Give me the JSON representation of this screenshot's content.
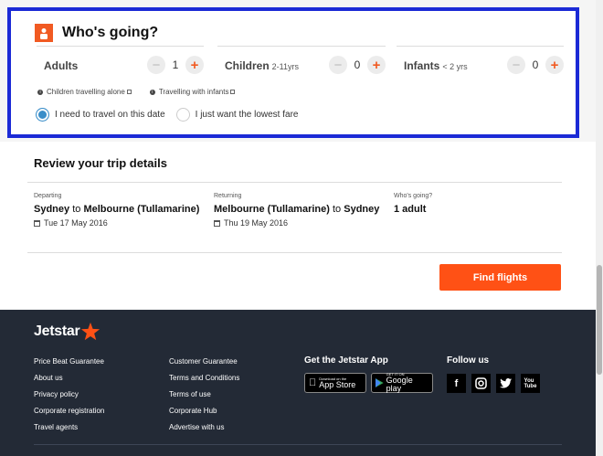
{
  "whos_going": {
    "title": "Who's going?",
    "icon": "person-icon",
    "adults": {
      "label": "Adults",
      "sub": "",
      "count": "1"
    },
    "children": {
      "label": "Children",
      "sub": "2-11yrs",
      "count": "0"
    },
    "infants": {
      "label": "Infants",
      "sub": "< 2 yrs",
      "count": "0"
    },
    "minus": "−",
    "plus": "+",
    "info_links": [
      "Children travelling alone",
      "Travelling with infants"
    ],
    "radio_options": [
      "I need to travel on this date",
      "I just want the lowest fare"
    ],
    "selected_option": "I need to travel on this date"
  },
  "review": {
    "title": "Review your trip details",
    "departing": {
      "label": "Departing",
      "from": "Sydney",
      "to_word": "to",
      "to": "Melbourne (Tullamarine)",
      "date": "Tue 17 May 2016"
    },
    "returning": {
      "label": "Returning",
      "from": "Melbourne (Tullamarine)",
      "to_word": "to",
      "to": "Sydney",
      "date": "Thu 19 May 2016"
    },
    "passengers": {
      "label": "Who's going?",
      "value": "1 adult"
    },
    "cta": "Find flights"
  },
  "footer": {
    "logo": "Jetstar",
    "col1": [
      "Price Beat Guarantee",
      "About us",
      "Privacy policy",
      "Corporate registration",
      "Travel agents"
    ],
    "col2": [
      "Customer Guarantee",
      "Terms and Conditions",
      "Terms of use",
      "Corporate Hub",
      "Advertise with us"
    ],
    "app_title": "Get the Jetstar App",
    "app_store": {
      "small": "Download on the",
      "big": "App Store"
    },
    "google_play": {
      "small": "GET IT ON",
      "big": "Google play"
    },
    "follow_title": "Follow us",
    "social": [
      "facebook-icon",
      "instagram-icon",
      "twitter-icon",
      "youtube-icon"
    ]
  },
  "colors": {
    "accent": "#ff5115",
    "focus_border": "#1b2ad6",
    "footer_bg": "#232a36",
    "radio_selected": "#3a8ec9"
  }
}
